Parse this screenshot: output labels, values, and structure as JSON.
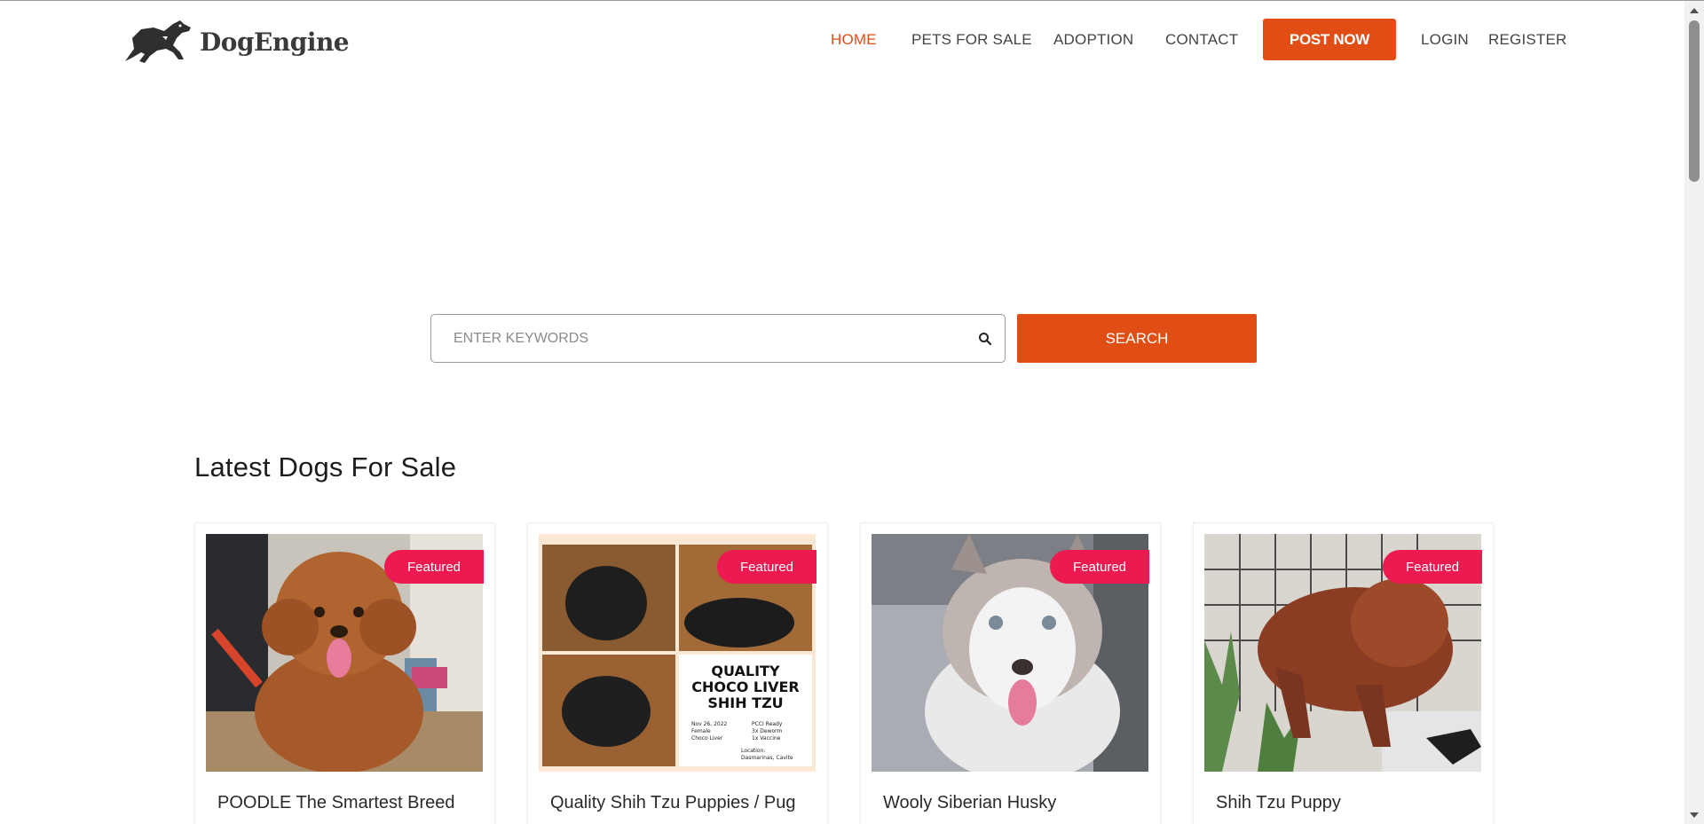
{
  "brand": {
    "name": "DogEngine",
    "logo_icon": "running-dog-icon"
  },
  "nav": {
    "items": [
      {
        "label": "HOME",
        "active": true
      },
      {
        "label": "PETS FOR SALE",
        "active": false
      },
      {
        "label": "ADOPTION",
        "active": false
      },
      {
        "label": "CONTACT",
        "active": false
      }
    ],
    "post_label": "POST NOW",
    "login_label": "LOGIN",
    "register_label": "REGISTER"
  },
  "search": {
    "placeholder": "ENTER KEYWORDS",
    "value": "",
    "button_label": "SEARCH",
    "icon": "search-icon"
  },
  "section": {
    "title": "Latest Dogs For Sale",
    "listings": [
      {
        "title": "POODLE The Smartest Breed",
        "badge": "Featured"
      },
      {
        "title": "Quality Shih Tzu Puppies / Pug",
        "badge": "Featured",
        "poster_text": {
          "line1": "QUALITY",
          "line2": "CHOCO LIVER",
          "line3": "SHIH TZU",
          "left_info": [
            "Nov 26, 2022",
            "Female",
            "Choco Liver"
          ],
          "right_info": [
            "PCCI Ready",
            "3x Deworm",
            "1x Vaccine"
          ],
          "location_label": "Location:",
          "location": "Dasmarinas, Cavite"
        }
      },
      {
        "title": "Wooly Siberian Husky",
        "badge": "Featured"
      },
      {
        "title": "Shih Tzu Puppy",
        "badge": "Featured"
      }
    ]
  },
  "colors": {
    "accent": "#e04e15",
    "badge": "#ec1a50",
    "text": "#333333"
  }
}
